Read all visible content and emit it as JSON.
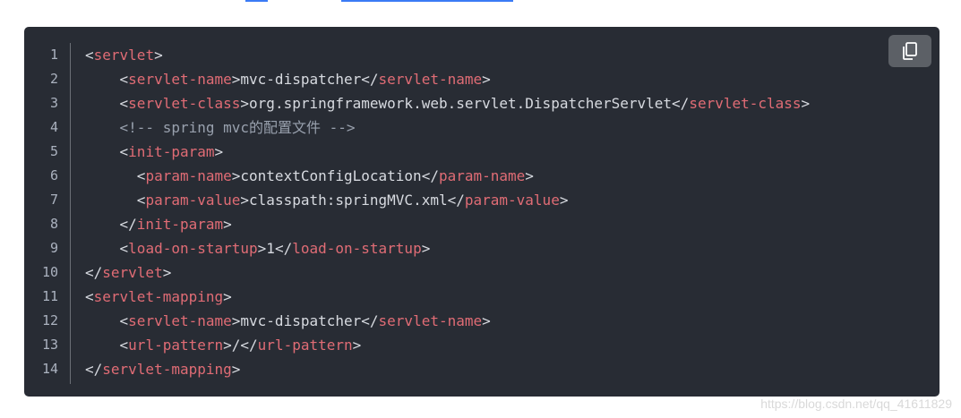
{
  "code": {
    "lines": [
      {
        "num": "1",
        "tokens": [
          {
            "t": "<",
            "c": "punct"
          },
          {
            "t": "servlet",
            "c": "tag"
          },
          {
            "t": ">",
            "c": "punct"
          }
        ]
      },
      {
        "num": "2",
        "tokens": [
          {
            "t": "    <",
            "c": "punct"
          },
          {
            "t": "servlet-name",
            "c": "tag"
          },
          {
            "t": ">mvc-dispatcher</",
            "c": "text"
          },
          {
            "t": "servlet-name",
            "c": "tag"
          },
          {
            "t": ">",
            "c": "punct"
          }
        ]
      },
      {
        "num": "3",
        "tokens": [
          {
            "t": "    <",
            "c": "punct"
          },
          {
            "t": "servlet-class",
            "c": "tag"
          },
          {
            "t": ">org.springframework.web.servlet.DispatcherServlet</",
            "c": "text"
          },
          {
            "t": "servlet-class",
            "c": "tag"
          },
          {
            "t": ">",
            "c": "punct"
          }
        ]
      },
      {
        "num": "4",
        "tokens": [
          {
            "t": "    <!-- spring mvc的配置文件 -->",
            "c": "comment"
          }
        ]
      },
      {
        "num": "5",
        "tokens": [
          {
            "t": "    <",
            "c": "punct"
          },
          {
            "t": "init-param",
            "c": "tag"
          },
          {
            "t": ">",
            "c": "punct"
          }
        ]
      },
      {
        "num": "6",
        "tokens": [
          {
            "t": "      <",
            "c": "punct"
          },
          {
            "t": "param-name",
            "c": "tag"
          },
          {
            "t": ">contextConfigLocation</",
            "c": "text"
          },
          {
            "t": "param-name",
            "c": "tag"
          },
          {
            "t": ">",
            "c": "punct"
          }
        ]
      },
      {
        "num": "7",
        "tokens": [
          {
            "t": "      <",
            "c": "punct"
          },
          {
            "t": "param-value",
            "c": "tag"
          },
          {
            "t": ">classpath:springMVC.xml</",
            "c": "text"
          },
          {
            "t": "param-value",
            "c": "tag"
          },
          {
            "t": ">",
            "c": "punct"
          }
        ]
      },
      {
        "num": "8",
        "tokens": [
          {
            "t": "    </",
            "c": "punct"
          },
          {
            "t": "init-param",
            "c": "tag"
          },
          {
            "t": ">",
            "c": "punct"
          }
        ]
      },
      {
        "num": "9",
        "tokens": [
          {
            "t": "    <",
            "c": "punct"
          },
          {
            "t": "load-on-startup",
            "c": "tag"
          },
          {
            "t": ">1</",
            "c": "text"
          },
          {
            "t": "load-on-startup",
            "c": "tag"
          },
          {
            "t": ">",
            "c": "punct"
          }
        ]
      },
      {
        "num": "10",
        "tokens": [
          {
            "t": "</",
            "c": "punct"
          },
          {
            "t": "servlet",
            "c": "tag"
          },
          {
            "t": ">",
            "c": "punct"
          }
        ]
      },
      {
        "num": "11",
        "tokens": [
          {
            "t": "<",
            "c": "punct"
          },
          {
            "t": "servlet-mapping",
            "c": "tag"
          },
          {
            "t": ">",
            "c": "punct"
          }
        ]
      },
      {
        "num": "12",
        "tokens": [
          {
            "t": "    <",
            "c": "punct"
          },
          {
            "t": "servlet-name",
            "c": "tag"
          },
          {
            "t": ">mvc-dispatcher</",
            "c": "text"
          },
          {
            "t": "servlet-name",
            "c": "tag"
          },
          {
            "t": ">",
            "c": "punct"
          }
        ]
      },
      {
        "num": "13",
        "tokens": [
          {
            "t": "    <",
            "c": "punct"
          },
          {
            "t": "url-pattern",
            "c": "tag"
          },
          {
            "t": ">/</",
            "c": "text"
          },
          {
            "t": "url-pattern",
            "c": "tag"
          },
          {
            "t": ">",
            "c": "punct"
          }
        ]
      },
      {
        "num": "14",
        "tokens": [
          {
            "t": "</",
            "c": "punct"
          },
          {
            "t": "servlet-mapping",
            "c": "tag"
          },
          {
            "t": ">",
            "c": "punct"
          }
        ]
      }
    ]
  },
  "toolbar": {
    "copy_icon": "copy-icon"
  },
  "watermark": {
    "text": "https://blog.csdn.net/qq_41611829"
  },
  "colors": {
    "background": "#282c34",
    "tag": "#e06c75",
    "text": "#d7dae0",
    "comment": "#98a0ad",
    "line_number": "#abb2bf",
    "copy_button": "#5c6066",
    "link_underline": "#3b7bf5"
  }
}
